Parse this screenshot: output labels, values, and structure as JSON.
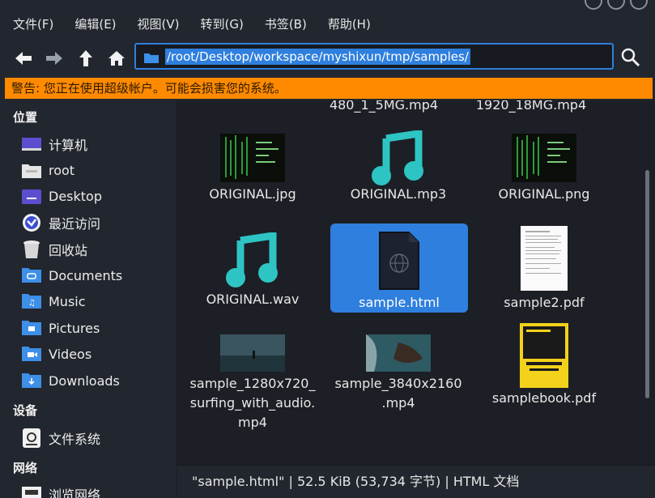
{
  "menubar": {
    "items": [
      "文件(F)",
      "编辑(E)",
      "视图(V)",
      "转到(G)",
      "书签(B)",
      "帮助(H)"
    ]
  },
  "toolbar": {
    "location_value": "/root/Desktop/workspace/myshixun/tmp/samples/"
  },
  "warning": {
    "text": "警告: 您正在使用超级帐户。可能会损害您的系统。"
  },
  "sidebar": {
    "places_heading": "位置",
    "places": [
      "计算机",
      "root",
      "Desktop",
      "最近访问",
      "回收站",
      "Documents",
      "Music",
      "Pictures",
      "Videos",
      "Downloads"
    ],
    "devices_heading": "设备",
    "devices": [
      "文件系统"
    ],
    "network_heading": "网络",
    "network": [
      "浏览网络"
    ]
  },
  "files": {
    "partial_top": [
      "480_1_5MG.mp4",
      "1920_18MG.mp4"
    ],
    "row1": [
      "ORIGINAL.jpg",
      "ORIGINAL.mp3",
      "ORIGINAL.png"
    ],
    "row2": [
      "ORIGINAL.wav",
      "sample.html",
      "sample2.pdf"
    ],
    "row3": [
      {
        "line1": "sample_1280x720_",
        "line2": "surfing_with_audio.",
        "line3": "mp4"
      },
      {
        "line1": "sample_3840x2160",
        "line2": ".mp4"
      },
      {
        "line1": "samplebook.pdf"
      }
    ]
  },
  "statusbar": {
    "text": "\"sample.html\" | 52.5 KiB (53,734 字节) | HTML 文档"
  },
  "colors": {
    "accent": "#2f7fde",
    "warning": "#ff8a00",
    "music_icon": "#2ec4c4"
  }
}
